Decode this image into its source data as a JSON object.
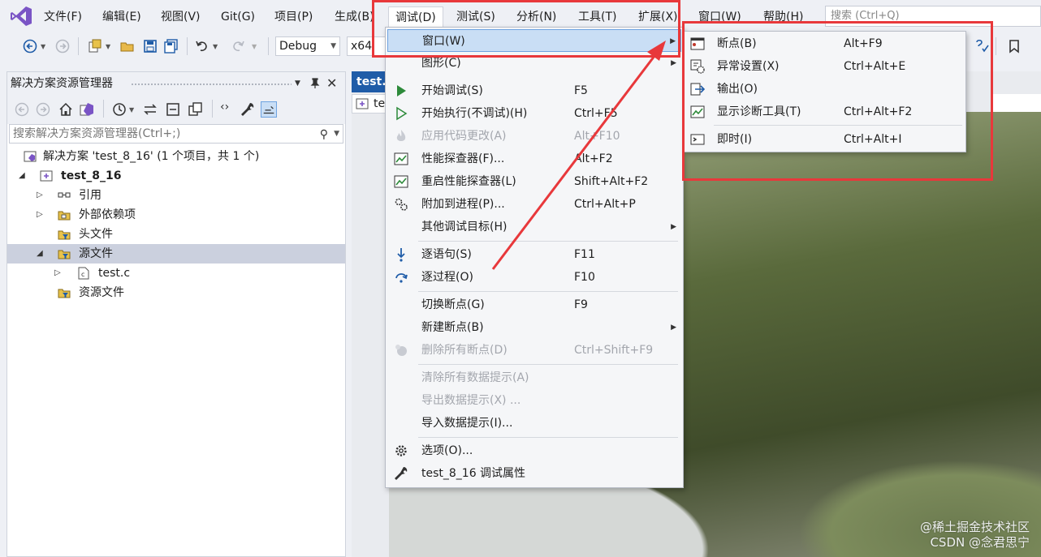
{
  "menubar": {
    "items": [
      "文件(F)",
      "编辑(E)",
      "视图(V)",
      "Git(G)",
      "项目(P)",
      "生成(B)",
      "调试(D)",
      "测试(S)",
      "分析(N)",
      "工具(T)",
      "扩展(X)",
      "窗口(W)",
      "帮助(H)"
    ],
    "search_placeholder": "搜索 (Ctrl+Q)"
  },
  "toolbar": {
    "configuration": "Debug",
    "platform": "x64"
  },
  "solution_explorer": {
    "title": "解决方案资源管理器",
    "search_placeholder": "搜索解决方案资源管理器(Ctrl+;)",
    "tree": [
      {
        "label": "解决方案 'test_8_16' (1 个项目，共 1 个)",
        "icon": "solution-icon"
      },
      {
        "label": "test_8_16",
        "icon": "project-icon",
        "bold": true
      },
      {
        "label": "引用",
        "icon": "references-icon"
      },
      {
        "label": "外部依赖项",
        "icon": "external-deps-icon"
      },
      {
        "label": "头文件",
        "icon": "filter-folder-icon"
      },
      {
        "label": "源文件",
        "icon": "filter-folder-icon",
        "selected": true
      },
      {
        "label": "test.c",
        "icon": "c-file-icon"
      },
      {
        "label": "资源文件",
        "icon": "filter-folder-icon"
      }
    ]
  },
  "editor": {
    "tab_label": "test.c",
    "nav_label": "te"
  },
  "debug_menu": {
    "items": [
      {
        "label": "窗口(W)",
        "shortcut": "",
        "submenu": true,
        "icon": "",
        "hover": true
      },
      {
        "label": "图形(C)",
        "shortcut": "",
        "submenu": true,
        "icon": ""
      },
      {
        "label": "开始调试(S)",
        "shortcut": "F5",
        "icon": "play-icon"
      },
      {
        "label": "开始执行(不调试)(H)",
        "shortcut": "Ctrl+F5",
        "icon": "play-outline-icon"
      },
      {
        "label": "应用代码更改(A)",
        "shortcut": "Alt+F10",
        "icon": "flame-icon",
        "disabled": true
      },
      {
        "label": "性能探查器(F)...",
        "shortcut": "Alt+F2",
        "icon": "profiler-icon"
      },
      {
        "label": "重启性能探查器(L)",
        "shortcut": "Shift+Alt+F2",
        "icon": "profiler-icon"
      },
      {
        "label": "附加到进程(P)...",
        "shortcut": "Ctrl+Alt+P",
        "icon": "gears-icon"
      },
      {
        "label": "其他调试目标(H)",
        "shortcut": "",
        "submenu": true,
        "icon": ""
      },
      {
        "label": "逐语句(S)",
        "shortcut": "F11",
        "icon": "step-into-icon"
      },
      {
        "label": "逐过程(O)",
        "shortcut": "F10",
        "icon": "step-over-icon"
      },
      {
        "label": "切换断点(G)",
        "shortcut": "F9",
        "icon": ""
      },
      {
        "label": "新建断点(B)",
        "shortcut": "",
        "submenu": true,
        "icon": ""
      },
      {
        "label": "删除所有断点(D)",
        "shortcut": "Ctrl+Shift+F9",
        "icon": "delete-breakpoints-icon",
        "disabled": true
      },
      {
        "label": "清除所有数据提示(A)",
        "shortcut": "",
        "icon": "",
        "disabled": true
      },
      {
        "label": "导出数据提示(X) ...",
        "shortcut": "",
        "icon": "",
        "disabled": true
      },
      {
        "label": "导入数据提示(I)...",
        "shortcut": "",
        "icon": ""
      },
      {
        "label": "选项(O)...",
        "shortcut": "",
        "icon": "gear-icon"
      },
      {
        "label": "test_8_16 调试属性",
        "shortcut": "",
        "icon": "wrench-icon"
      }
    ]
  },
  "window_submenu": {
    "items": [
      {
        "label": "断点(B)",
        "shortcut": "Alt+F9",
        "icon": "breakpoints-window-icon"
      },
      {
        "label": "异常设置(X)",
        "shortcut": "Ctrl+Alt+E",
        "icon": "exception-settings-icon"
      },
      {
        "label": "输出(O)",
        "shortcut": "",
        "icon": "output-icon"
      },
      {
        "label": "显示诊断工具(T)",
        "shortcut": "Ctrl+Alt+F2",
        "icon": "diagnostics-icon"
      },
      {
        "label": "即时(I)",
        "shortcut": "Ctrl+Alt+I",
        "icon": "immediate-icon"
      }
    ]
  },
  "watermark": {
    "line1": "@稀土掘金技术社区",
    "line2": "CSDN @念君思宁"
  },
  "colors": {
    "annotation_red": "#e8383b",
    "accent_blue": "#1f5ca8",
    "hover_blue": "#c9def5"
  }
}
